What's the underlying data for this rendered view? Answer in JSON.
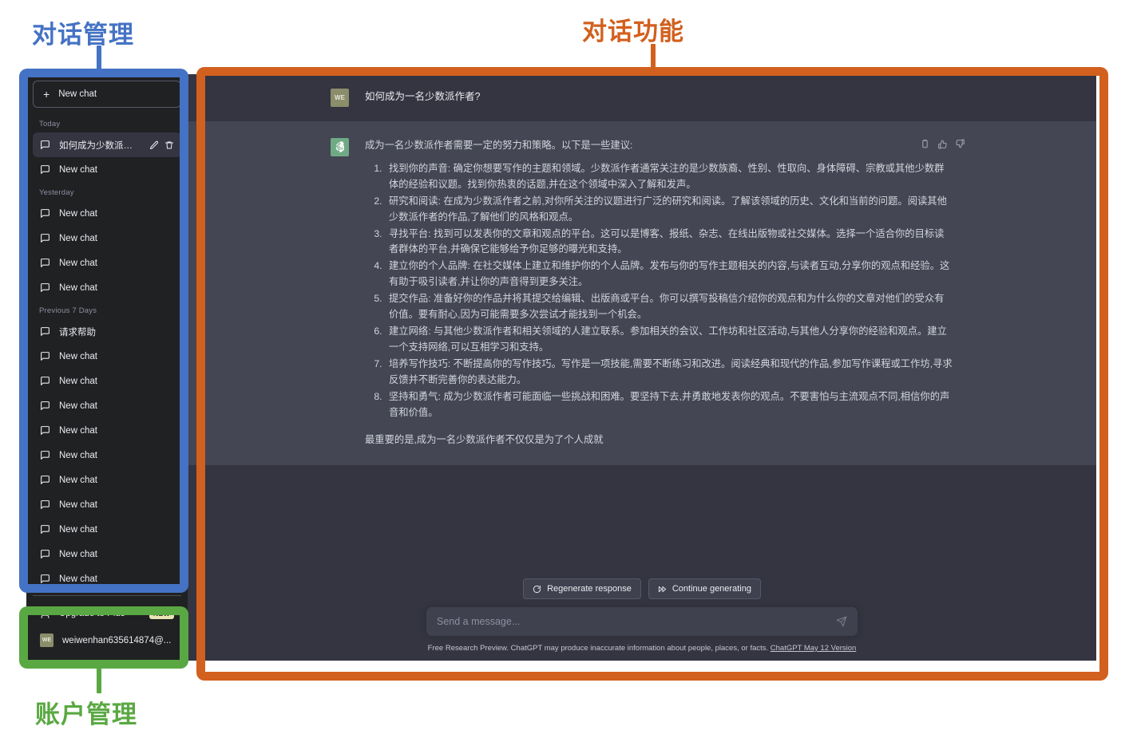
{
  "annotations": [
    {
      "id": "sidebar",
      "text": "对话管理",
      "color": "#4472C4"
    },
    {
      "id": "conversation",
      "text": "对话功能",
      "color": "#D2601E"
    },
    {
      "id": "account",
      "text": "账户管理",
      "color": "#5AA843"
    }
  ],
  "sidebar": {
    "new_chat_label": "New chat",
    "groups": [
      {
        "title": "Today",
        "items": [
          {
            "label": "如何成为少数派作者?",
            "active": true,
            "has_actions": true
          },
          {
            "label": "New chat",
            "active": false,
            "has_actions": false
          }
        ]
      },
      {
        "title": "Yesterday",
        "items": [
          {
            "label": "New chat",
            "active": false,
            "has_actions": false
          },
          {
            "label": "New chat",
            "active": false,
            "has_actions": false
          },
          {
            "label": "New chat",
            "active": false,
            "has_actions": false
          },
          {
            "label": "New chat",
            "active": false,
            "has_actions": false
          }
        ]
      },
      {
        "title": "Previous 7 Days",
        "items": [
          {
            "label": "请求帮助",
            "active": false,
            "has_actions": false
          },
          {
            "label": "New chat",
            "active": false,
            "has_actions": false
          },
          {
            "label": "New chat",
            "active": false,
            "has_actions": false
          },
          {
            "label": "New chat",
            "active": false,
            "has_actions": false
          },
          {
            "label": "New chat",
            "active": false,
            "has_actions": false
          },
          {
            "label": "New chat",
            "active": false,
            "has_actions": false
          },
          {
            "label": "New chat",
            "active": false,
            "has_actions": false
          },
          {
            "label": "New chat",
            "active": false,
            "has_actions": false
          },
          {
            "label": "New chat",
            "active": false,
            "has_actions": false
          },
          {
            "label": "New chat",
            "active": false,
            "has_actions": false
          },
          {
            "label": "New chat",
            "active": false,
            "has_actions": false
          }
        ]
      }
    ],
    "footer": {
      "upgrade_label": "Upgrade to Plus",
      "upgrade_badge": "NEW",
      "account_label": "weiwenhan635614874@...",
      "account_avatar_initials": "WE"
    }
  },
  "conversation": {
    "user_message": {
      "avatar_initials": "WE",
      "text": "如何成为一名少数派作者?"
    },
    "assistant_message": {
      "intro": "成为一名少数派作者需要一定的努力和策略。以下是一些建议:",
      "list": [
        "找到你的声音: 确定你想要写作的主题和领域。少数派作者通常关注的是少数族裔、性别、性取向、身体障碍、宗教或其他少数群体的经验和议题。找到你热衷的话题,并在这个领域中深入了解和发声。",
        "研究和阅读: 在成为少数派作者之前,对你所关注的议题进行广泛的研究和阅读。了解该领域的历史、文化和当前的问题。阅读其他少数派作者的作品,了解他们的风格和观点。",
        "寻找平台: 找到可以发表你的文章和观点的平台。这可以是博客、报纸、杂志、在线出版物或社交媒体。选择一个适合你的目标读者群体的平台,并确保它能够给予你足够的曝光和支持。",
        "建立你的个人品牌: 在社交媒体上建立和维护你的个人品牌。发布与你的写作主题相关的内容,与读者互动,分享你的观点和经验。这有助于吸引读者,并让你的声音得到更多关注。",
        "提交作品: 准备好你的作品并将其提交给编辑、出版商或平台。你可以撰写投稿信介绍你的观点和为什么你的文章对他们的受众有价值。要有耐心,因为可能需要多次尝试才能找到一个机会。",
        "建立网络: 与其他少数派作者和相关领域的人建立联系。参加相关的会议、工作坊和社区活动,与其他人分享你的经验和观点。建立一个支持网络,可以互相学习和支持。",
        "培养写作技巧: 不断提高你的写作技巧。写作是一项技能,需要不断练习和改进。阅读经典和现代的作品,参加写作课程或工作坊,寻求反馈并不断完善你的表达能力。",
        "坚持和勇气: 成为少数派作者可能面临一些挑战和困难。要坚持下去,并勇敢地发表你的观点。不要害怕与主流观点不同,相信你的声音和价值。"
      ],
      "closing": "最重要的是,成为一名少数派作者不仅仅是为了个人成就"
    }
  },
  "controls": {
    "regenerate_label": "Regenerate response",
    "continue_label": "Continue generating",
    "composer_placeholder": "Send a message...",
    "composer_value": "",
    "disclaimer_prefix": "Free Research Preview. ChatGPT may produce inaccurate information about people, places, or facts. ",
    "disclaimer_link": "ChatGPT May 12 Version"
  }
}
